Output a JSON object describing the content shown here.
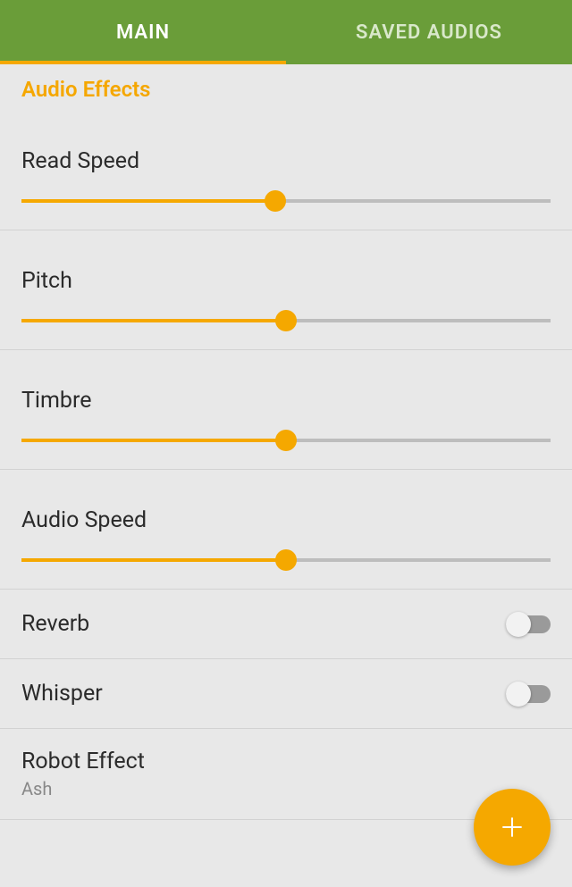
{
  "tabs": {
    "main": "MAIN",
    "saved": "SAVED AUDIOS",
    "active": "main"
  },
  "sectionTitle": "Audio Effects",
  "sliders": {
    "readSpeed": {
      "label": "Read Speed",
      "value": 48
    },
    "pitch": {
      "label": "Pitch",
      "value": 50
    },
    "timbre": {
      "label": "Timbre",
      "value": 50
    },
    "audioSpeed": {
      "label": "Audio Speed",
      "value": 50
    }
  },
  "toggles": {
    "reverb": {
      "label": "Reverb",
      "on": false
    },
    "whisper": {
      "label": "Whisper",
      "on": false
    }
  },
  "robotEffect": {
    "label": "Robot Effect",
    "value": "Ash"
  },
  "colors": {
    "accent": "#f5a800",
    "tabbar": "#6a9d39"
  }
}
